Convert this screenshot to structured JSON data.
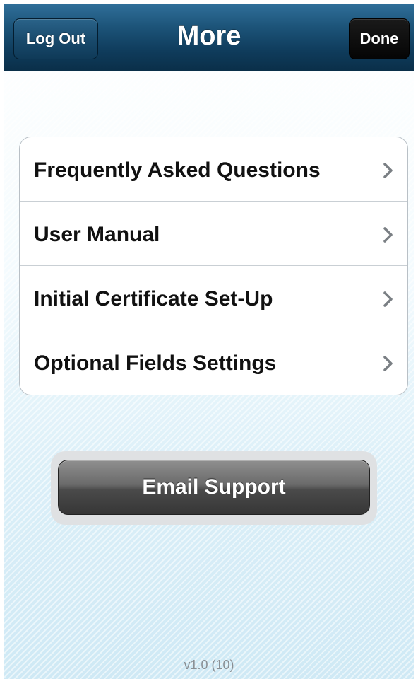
{
  "navbar": {
    "title": "More",
    "logout_label": "Log Out",
    "done_label": "Done"
  },
  "menu": {
    "items": [
      {
        "label": "Frequently Asked Questions",
        "icon": "chevron-right-icon"
      },
      {
        "label": "User Manual",
        "icon": "chevron-right-icon"
      },
      {
        "label": "Initial Certificate Set-Up",
        "icon": "chevron-right-icon"
      },
      {
        "label": "Optional Fields Settings",
        "icon": "chevron-right-icon"
      }
    ]
  },
  "email_support_label": "Email Support",
  "version": "v1.0 (10)",
  "colors": {
    "navbar": "#1c5378",
    "done_button": "#050505",
    "background": "#dbeff8",
    "email_button": "#4a4a4a"
  }
}
